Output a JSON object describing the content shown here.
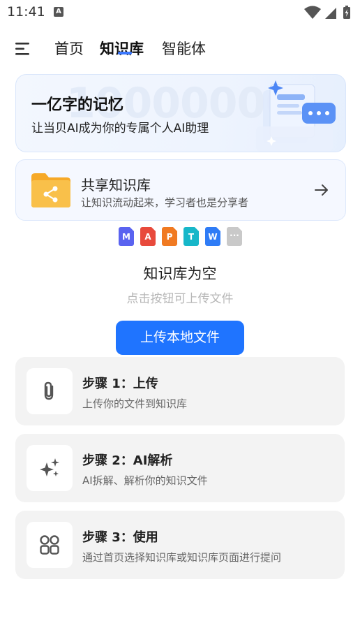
{
  "status": {
    "time": "11:41",
    "notif_letter": "A"
  },
  "nav": {
    "tabs": [
      {
        "label": "首页",
        "active": false
      },
      {
        "label": "知识库",
        "active": true
      },
      {
        "label": "智能体",
        "active": false
      }
    ]
  },
  "banner": {
    "bg_number": "10000000",
    "title": "一亿字的记忆",
    "subtitle": "让当贝AI成为你的专属个人AI助理"
  },
  "shared": {
    "title": "共享知识库",
    "subtitle": "让知识流动起来，学习者也是分享者"
  },
  "file_types": [
    {
      "name": "markdown-file-icon",
      "letter": "M",
      "color": "#5a63f0"
    },
    {
      "name": "pdf-file-icon",
      "letter": "A",
      "color": "#e84a3c"
    },
    {
      "name": "ppt-file-icon",
      "letter": "P",
      "color": "#f07a22"
    },
    {
      "name": "txt-file-icon",
      "letter": "T",
      "color": "#17b7c9"
    },
    {
      "name": "word-file-icon",
      "letter": "W",
      "color": "#2f7cf6"
    },
    {
      "name": "other-file-icon",
      "letter": "···",
      "color": "#c9c9c9"
    }
  ],
  "empty": {
    "title": "知识库为空",
    "subtitle": "点击按钮可上传文件"
  },
  "upload_button": "上传本地文件",
  "steps": [
    {
      "icon": "paperclip-icon",
      "title": "步骤 1：上传",
      "desc": "上传你的文件到知识库"
    },
    {
      "icon": "sparkle-icon",
      "title": "步骤 2：AI解析",
      "desc": "AI拆解、解析你的知识文件"
    },
    {
      "icon": "grid-icon",
      "title": "步骤 3：使用",
      "desc": "通过首页选择知识库或知识库页面进行提问"
    }
  ],
  "colors": {
    "accent": "#1f74ff",
    "folder": "#f7b93a"
  }
}
